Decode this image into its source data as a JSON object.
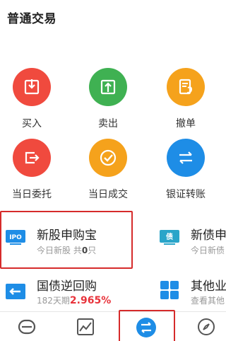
{
  "header": {
    "title": "普通交易"
  },
  "grid": [
    {
      "label": "买入",
      "icon": "buy-icon",
      "color": "#f04a3e"
    },
    {
      "label": "卖出",
      "icon": "sell-icon",
      "color": "#3fb152"
    },
    {
      "label": "撤单",
      "icon": "cancel-order-icon",
      "color": "#f5a21c"
    },
    {
      "label": "当日委托",
      "icon": "today-order-icon",
      "color": "#f04a3e"
    },
    {
      "label": "当日成交",
      "icon": "today-deal-icon",
      "color": "#f5a21c"
    },
    {
      "label": "银证转账",
      "icon": "transfer-icon",
      "color": "#1e8de6"
    }
  ],
  "cards": {
    "ipo": {
      "title": "新股申购宝",
      "sub_prefix": "今日新股 共",
      "count": "0",
      "sub_suffix": "只",
      "icon_text": "IPO"
    },
    "bond": {
      "title": "新债申",
      "sub": "今日新债",
      "icon_text": "债"
    },
    "repo": {
      "title": "国债逆回购",
      "sub_prefix": "182天期",
      "rate": "2.965%"
    },
    "other": {
      "title": "其他业",
      "sub": "查看其他"
    }
  },
  "colors": {
    "highlight": "#d62b2b",
    "rate": "#e8333b"
  },
  "tabbar": [
    {
      "icon": "home-icon"
    },
    {
      "icon": "market-chart-icon"
    },
    {
      "icon": "trade-exchange-icon",
      "active": true
    },
    {
      "icon": "discover-compass-icon"
    }
  ]
}
